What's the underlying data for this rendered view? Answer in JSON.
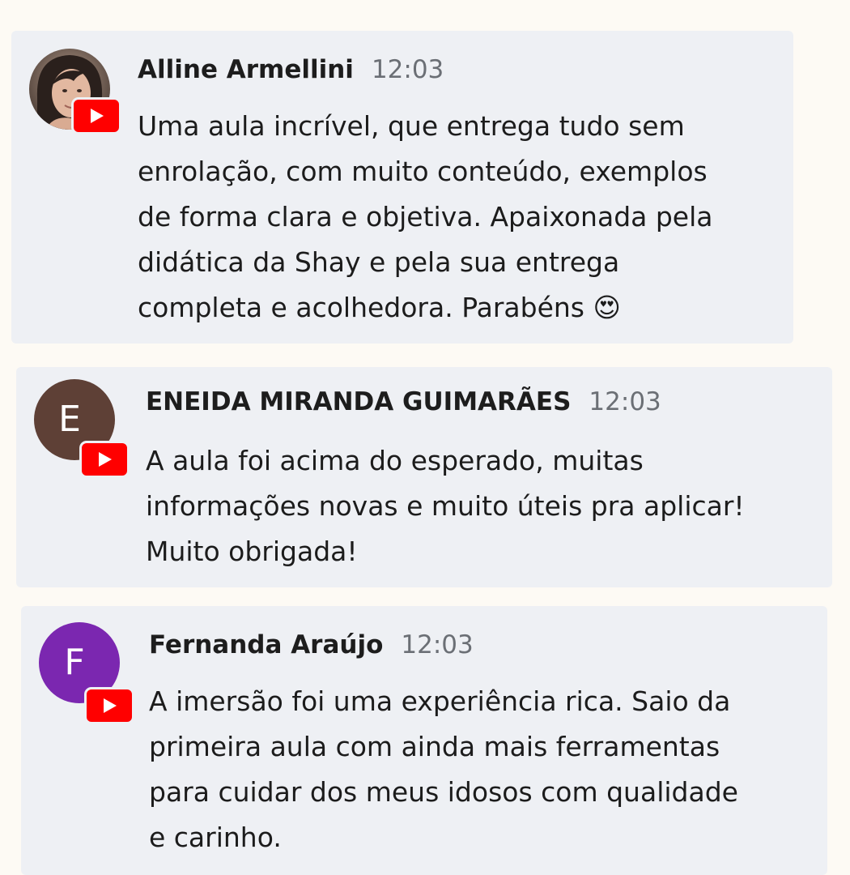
{
  "colors": {
    "page_background": "#fdfaf4",
    "card_background": "#eef0f4",
    "youtube_red": "#ff0000",
    "timestamp_gray": "#6b6f75"
  },
  "comments": [
    {
      "author": "Alline Armellini",
      "time": "12:03",
      "avatar": {
        "type": "photo",
        "letter": ""
      },
      "platform_icon": "youtube-icon",
      "lines": [
        "Uma aula incrível, que entrega tudo sem",
        "enrolação, com muito conteúdo, exemplos",
        "de forma clara e objetiva. Apaixonada pela",
        "didática da Shay e pela sua entrega",
        "completa e acolhedora. Parabéns 😍"
      ]
    },
    {
      "author": "ENEIDA MIRANDA GUIMARÃES",
      "time": "12:03",
      "avatar": {
        "type": "letter",
        "letter": "E",
        "color": "#5e4036"
      },
      "platform_icon": "youtube-icon",
      "lines": [
        "A aula foi acima do esperado, muitas",
        "informações novas e muito úteis pra aplicar!",
        "Muito obrigada!"
      ]
    },
    {
      "author": "Fernanda Araújo",
      "time": "12:03",
      "avatar": {
        "type": "letter",
        "letter": "F",
        "color": "#7b27b0"
      },
      "platform_icon": "youtube-icon",
      "lines": [
        "A imersão foi uma experiência rica. Saio da",
        "primeira aula com ainda mais ferramentas",
        "para cuidar dos meus idosos com qualidade",
        "e carinho."
      ]
    }
  ]
}
